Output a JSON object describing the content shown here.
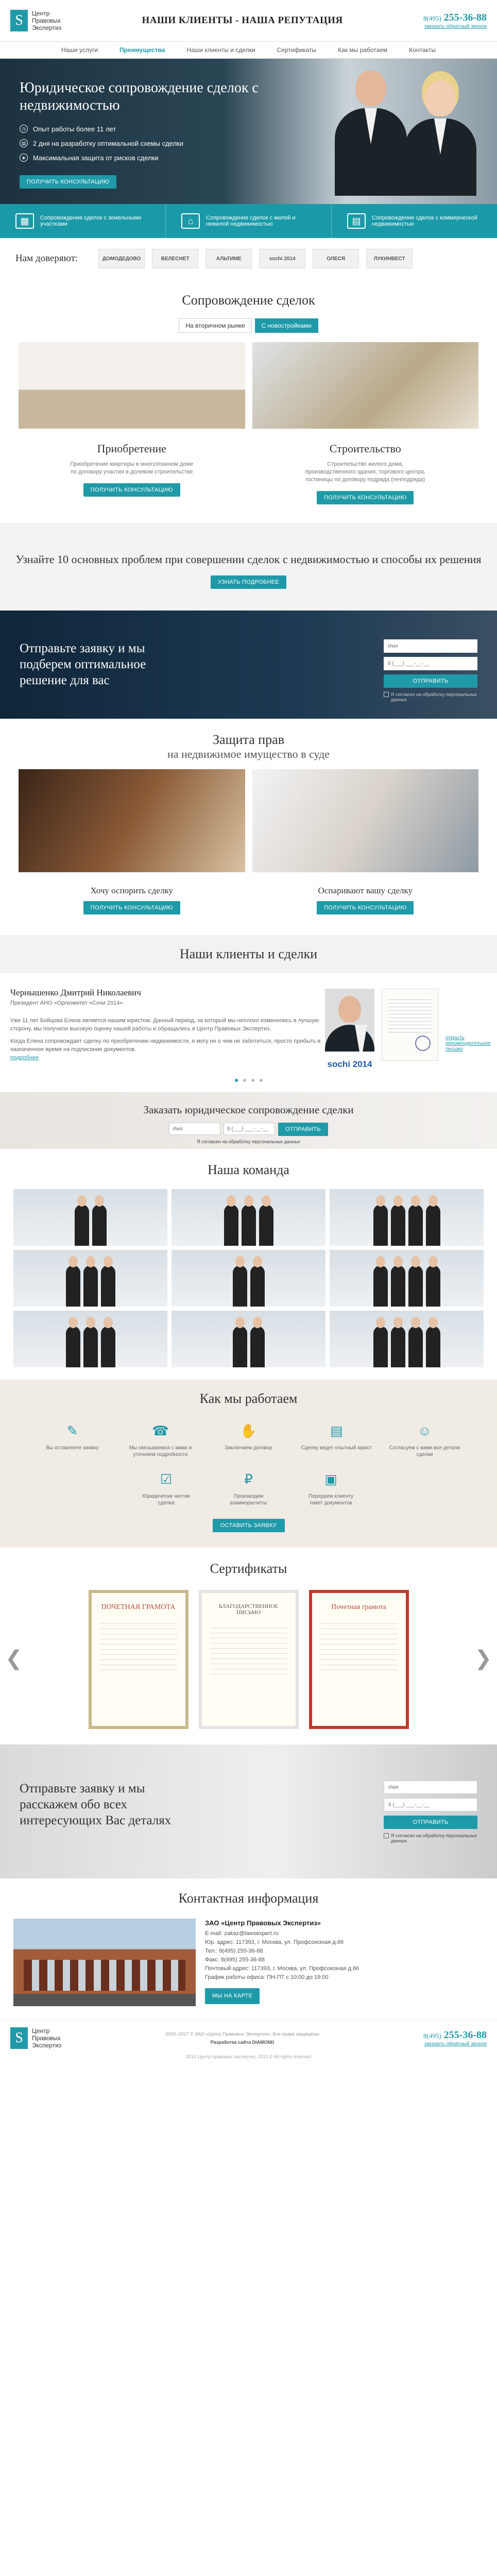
{
  "header": {
    "logo_letter": "S",
    "logo_text": [
      "Центр",
      "Правовых",
      "Экспертиз"
    ],
    "headline": "НАШИ КЛИЕНТЫ - НАША РЕПУТАЦИЯ",
    "phone_code": "8(495)",
    "phone_number": "255-36-88",
    "callback": "заказать обратный звонок"
  },
  "nav": [
    "Наши услуги",
    "Преимущества",
    "Наши клиенты и сделки",
    "Сертификаты",
    "Как мы работаем",
    "Контакты"
  ],
  "nav_active": "Преимущества",
  "hero": {
    "title": "Юридическое сопровождение сделок с недвижимостью",
    "bullets": [
      "Опыт работы более 11 лет",
      "2 дня на разработку оптимальной схемы сделки",
      "Максимальная защита от рисков сделки"
    ],
    "button": "ПОЛУЧИТЬ КОНСУЛЬТАЦИЮ"
  },
  "features": [
    {
      "icon": "land-icon",
      "glyph": "▦",
      "text": "Сопровождение сделок с земельными участками"
    },
    {
      "icon": "house-icon",
      "glyph": "⌂",
      "text": "Сопровождение сделок с жилой и нежилой недвижимостью"
    },
    {
      "icon": "calendar-icon",
      "glyph": "▤",
      "text": "Сопровождение сделок с коммерческой недвижимостью"
    }
  ],
  "trust": {
    "title": "Нам доверяют:",
    "logos": [
      "ДОМОДЕДОВО",
      "ВЕЛЕСНЕТ",
      "АЛЬТИМЕ",
      "sochi 2014",
      "ОЛЕСЯ",
      "ЛУКИНВЕСТ"
    ]
  },
  "accompaniment": {
    "title": "Сопровождение сделок",
    "tabs": [
      "На вторичном рынке",
      "С новостройками"
    ],
    "active_tab": "С новостройками",
    "items": [
      {
        "title": "Приобретение",
        "text": "Приобретение квартиры в многоэтажном доме по договору участия в долевом строительстве",
        "button": "ПОЛУЧИТЬ КОНСУЛЬТАЦИЮ"
      },
      {
        "title": "Строительство",
        "text": "Строительство жилого дома, производственного здания, торгового центра, гостиницы по договору подряда (генподряда)",
        "button": "ПОЛУЧИТЬ КОНСУЛЬТАЦИЮ"
      }
    ]
  },
  "problems": {
    "title": "Узнайте 10 основных проблем при совершении сделок с недвижимостью и способы их решения",
    "button": "УЗНАТЬ ПОДРОБНЕЕ"
  },
  "request_form": {
    "title": "Отправьте заявку и мы подберем оптимальное решение для вас",
    "name_placeholder": "Имя",
    "phone_placeholder": "8 (___) ___-__-__",
    "button": "ОТПРАВИТЬ",
    "agree": "Я согласен на обработку персональных данных"
  },
  "defence": {
    "title": "Защита прав",
    "subtitle": "на недвижимое имущество в суде",
    "items": [
      {
        "title": "Хочу оспорить сделку",
        "button": "ПОЛУЧИТЬ КОНСУЛЬТАЦИЮ"
      },
      {
        "title": "Оспаривают вашу сделку",
        "button": "ПОЛУЧИТЬ КОНСУЛЬТАЦИЮ"
      }
    ]
  },
  "clients": {
    "title": "Наши клиенты и сделки",
    "name": "Чернышенко Дмитрий Николаевич",
    "position": "Президент АНО «Оргкомитет «Сочи 2014»",
    "text1": "Уже 11 лет Бойцова Елена является нашим юристом. Данный период, за который мы неплохо изменились в лучшую сторону, мы получили высокую оценку нашей работы и обращались в Центр Правовых Экспертиз.",
    "text2": "Когда Елена сопровождает сделку по приобретению недвижимости, я могу не о чем не заботиться, просто прибыть в назначенное время на подписание документов.",
    "more": "подробнее",
    "sochi": "sochi 2014",
    "letter_link": "открыть рекомендательное письмо",
    "slides": 4,
    "active_slide": 1
  },
  "order": {
    "title": "Заказать юридическое сопровождение сделки",
    "name_placeholder": "Имя",
    "phone_placeholder": "8 (___) ___-__-__",
    "button": "ОТПРАВИТЬ",
    "agree": "Я согласен на обработку персональных данных"
  },
  "team": {
    "title": "Наша команда",
    "photos": 9
  },
  "how": {
    "title": "Как мы работаем",
    "steps": [
      {
        "icon": "pencil-icon",
        "glyph": "✎",
        "text": "Вы оставляете заявку"
      },
      {
        "icon": "phone-icon",
        "glyph": "☎",
        "text": "Мы связываемся с вами и уточняем подробности"
      },
      {
        "icon": "handshake-icon",
        "glyph": "✋",
        "text": "Заключаем договор"
      },
      {
        "icon": "document-icon",
        "glyph": "▤",
        "text": "Сделку ведет опытный юрист"
      },
      {
        "icon": "people-icon",
        "glyph": "☺",
        "text": "Согласуем с вами все детали сделки"
      },
      {
        "icon": "check-icon",
        "glyph": "☑",
        "text": "Юридически чистая сделка"
      },
      {
        "icon": "money-icon",
        "glyph": "₽",
        "text": "Производим взаиморасчеты"
      },
      {
        "icon": "folder-icon",
        "glyph": "▣",
        "text": "Передаем клиенту пакет документов"
      }
    ],
    "button": "ОСТАВИТЬ ЗАЯВКУ"
  },
  "certs": {
    "title": "Сертификаты",
    "items": [
      "ПОЧЕТНАЯ ГРАМОТА",
      "БЛАГОДАРСТВЕННОЕ ПИСЬМО",
      "Почетная грамота"
    ]
  },
  "final_form": {
    "title": "Отправьте заявку и мы расскажем обо всех интересующих Вас деталях",
    "name_placeholder": "Имя",
    "phone_placeholder": "8 (___) ___-__-__",
    "button": "ОТПРАВИТЬ",
    "agree": "Я согласен на обработку персональных данных"
  },
  "contacts": {
    "title": "Контактная информация",
    "company": "ЗАО «Центр Правовых Экспертиз»",
    "lines": [
      "E-mail: zakaz@lawsexpert.ru",
      "Юр. адрес: 117393, г. Москва, ул. Профсоюзная д.66",
      "Тел.: 8(495) 255-36-88",
      "Факс: 8(495) 255-36-88",
      "Почтовый адрес: 117393, г. Москва, ул. Профсоюзная д.66",
      "График работы офиса: ПН-ПТ с 10:00 до 19:00"
    ],
    "button": "МЫ НА КАРТЕ"
  },
  "footer": {
    "line1": "2005–2017 © ЗАО «Центр Правовых Экспертиз». Все права защищены",
    "developed": "Разработка сайта DIAMOND",
    "copyright": "2016 Центр правовых экспертиз, 2013 © All rights reserved"
  },
  "colors": {
    "accent": "#1f9aa8",
    "dark": "#1d3240"
  }
}
